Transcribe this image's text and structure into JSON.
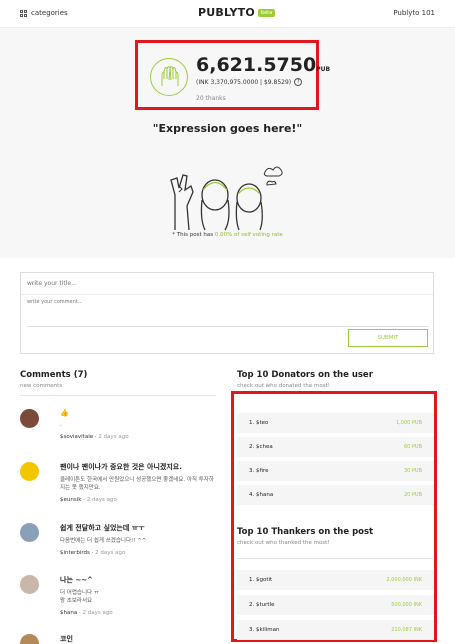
{
  "header": {
    "categories_label": "categories",
    "logo": "PUBLYTO",
    "beta_badge": "beta",
    "account": "Publyto 101"
  },
  "hero": {
    "amount": "6,621.5750",
    "amount_unit": "PUB",
    "ink_line": "(INK 3,370,975.0000 | $9.8529)",
    "help_glyph": "?",
    "thanks": "20 thanks",
    "expression": "\"Expression goes here!\"",
    "vote_prefix": "* This post has ",
    "vote_pct": "0.00% of self voting rate",
    "icon": "high-five-icon",
    "accent": "#9ccc3a"
  },
  "form": {
    "title_placeholder": "write your title...",
    "comment_placeholder": "write your comment...",
    "submit_label": "SUBMIT"
  },
  "comments": {
    "heading": "Comments (7)",
    "subheading": "new comments",
    "items": [
      {
        "title": "👍",
        "text": ".",
        "author": "$soviavitale",
        "date": "2 days ago"
      },
      {
        "title": "팬이나 팬이나가 중요한 것은 아니겠지요.",
        "text": "클레이튼도 한국에서 만원었으니 성공했으면 좋겠네요. 아직 투자하지는 못 했지만요.",
        "author": "$eunsik",
        "date": "2 days ago"
      },
      {
        "title": "쉽게 전달하고 싶었는데 ㅠㅜ",
        "text": "다음번에는 더 쉽게 쓰겠습니다!! ^^",
        "author": "$interbirds",
        "date": "2 days ago"
      },
      {
        "title": "나는 ~~^",
        "text": "더 어렵습니다 ㅠ\n왕 초보라서요",
        "author": "$hana",
        "date": "2 days ago"
      },
      {
        "title": "코인",
        "text": "",
        "author": "",
        "date": ""
      }
    ]
  },
  "donators": {
    "heading": "Top 10 Donators on the user",
    "subheading": "check out who donated the most!",
    "rows": [
      {
        "name": "1. $teo",
        "value": "1,000 PUB"
      },
      {
        "name": "2. $chea",
        "value": "60 PUB"
      },
      {
        "name": "3. $fire",
        "value": "30 PUB"
      },
      {
        "name": "4. $hana",
        "value": "20 PUB"
      }
    ]
  },
  "thankers": {
    "heading": "Top 10 Thankers on the post",
    "subheading": "check out who thanked the most!",
    "rows": [
      {
        "name": "1. $gotit",
        "value": "2,000,000 INK"
      },
      {
        "name": "2. $turtle",
        "value": "500,000 INK"
      },
      {
        "name": "3. $kiliman",
        "value": "210,087 INK"
      }
    ]
  }
}
